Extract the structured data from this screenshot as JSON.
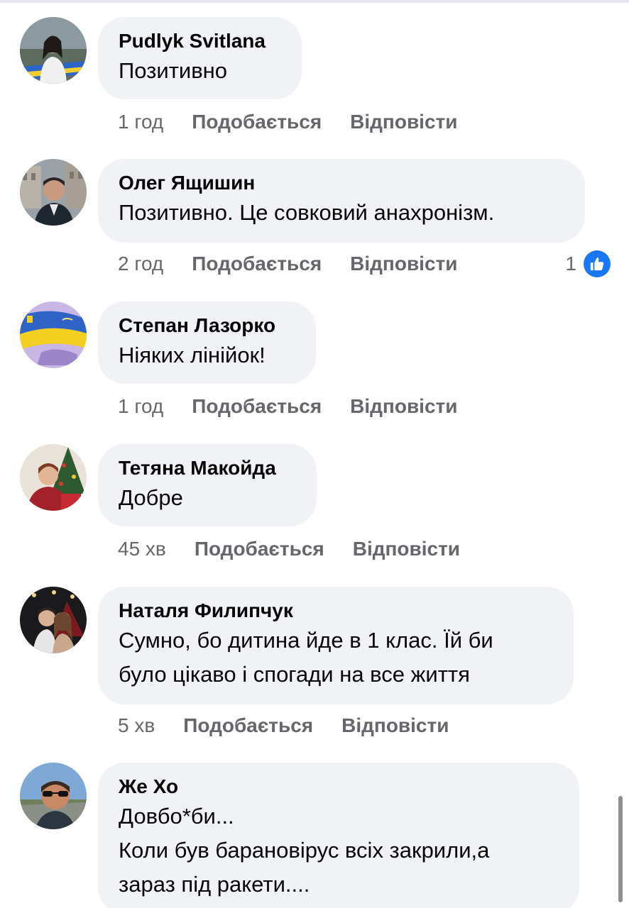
{
  "labels": {
    "like": "Подобається",
    "reply": "Відповісти"
  },
  "colors": {
    "bubble": "#f0f2f5",
    "meta_text": "#65676b",
    "like_blue": "#1877f2"
  },
  "comments": [
    {
      "author": "Pudlyk Svitlana",
      "text": "Позитивно",
      "time": "1 год",
      "avatar_icon": "profile-photo-woman-flag"
    },
    {
      "author": "Олег Ящишин",
      "text": "Позитивно. Це совковий анахронізм.",
      "time": "2 год",
      "reaction_count": "1",
      "reaction_icon": "thumbs-up-icon",
      "avatar_icon": "profile-photo-man-city"
    },
    {
      "author": "Степан Лазорко",
      "text": "Ніяких лінійок!",
      "time": "1 год",
      "avatar_icon": "profile-photo-ukraine-flag-map"
    },
    {
      "author": "Тетяна Макойда",
      "text": "Добре",
      "time": "45 хв",
      "avatar_icon": "profile-photo-woman-christmas-tree"
    },
    {
      "author": "Наталя Филипчук",
      "text": "Сумно, бо дитина йде в 1 клас. Їй би\nбуло цікаво і спогади на все життя",
      "time": "5 хв",
      "avatar_icon": "profile-photo-couple-christmas"
    },
    {
      "author": "Же Хо",
      "text": "Довбо*би...\nКоли був барановірус всіх закрили,а\nзараз під ракети....",
      "avatar_icon": "profile-photo-man-sunglasses"
    }
  ]
}
